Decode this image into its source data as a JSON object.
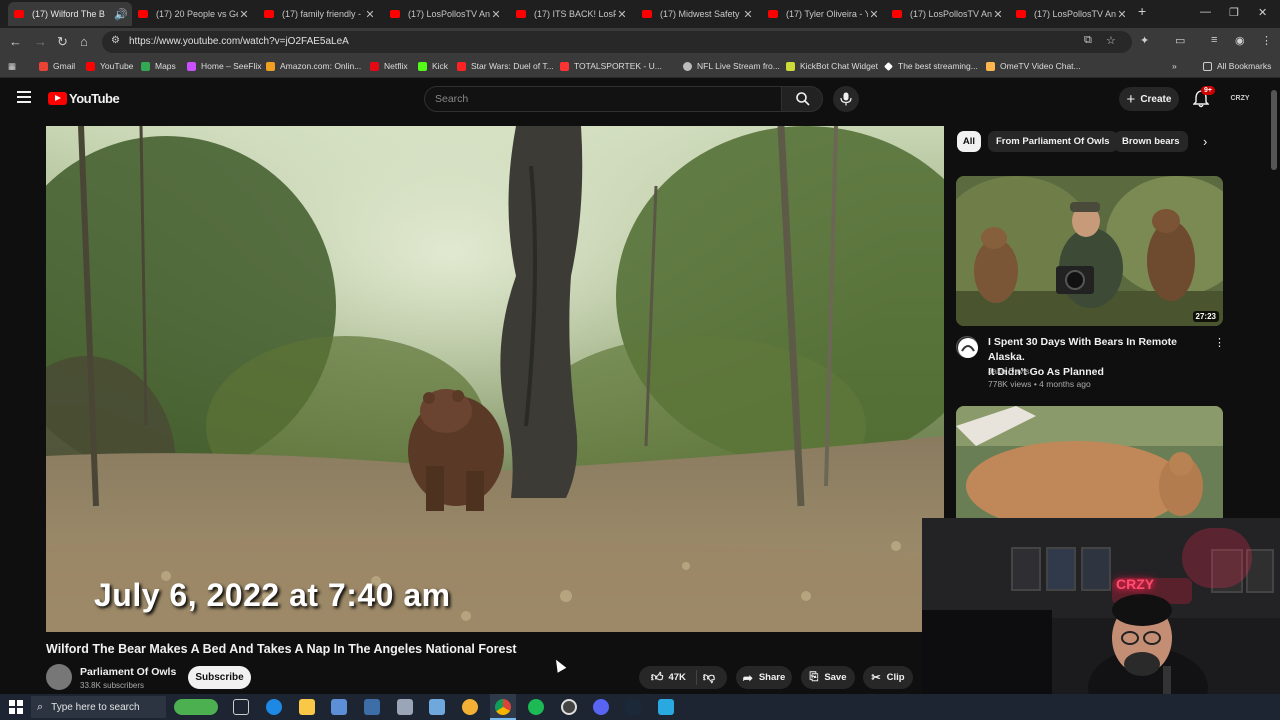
{
  "browser": {
    "tabs": [
      {
        "title": "(17) Wilford The B",
        "active": true
      },
      {
        "title": "(17) 20 People vs Gen"
      },
      {
        "title": "(17) family friendly - Y"
      },
      {
        "title": "(17) LosPollosTV And"
      },
      {
        "title": "(17) ITS BACK! LosPoll"
      },
      {
        "title": "(17) Midwest Safety -"
      },
      {
        "title": "(17) Tyler Oliveira - Yo"
      },
      {
        "title": "(17) LosPollosTV And"
      },
      {
        "title": "(17) LosPollosTV And"
      }
    ],
    "url": "https://www.youtube.com/watch?v=jO2FAE5aLeA",
    "bookmarks": [
      {
        "label": "Gmail",
        "color": "#ea4335"
      },
      {
        "label": "YouTube",
        "color": "#ff0000"
      },
      {
        "label": "Maps",
        "color": "#34a853"
      },
      {
        "label": "Home – SeeFlix",
        "color": "#c94fff"
      },
      {
        "label": "Amazon.com: Onlin...",
        "color": "#f0a020"
      },
      {
        "label": "Netflix",
        "color": "#e50914"
      },
      {
        "label": "Kick",
        "color": "#53fc18"
      },
      {
        "label": "Star Wars: Duel of T...",
        "color": "#ff2222"
      },
      {
        "label": "TOTALSPORTEK - U...",
        "color": "#ff3333"
      },
      {
        "label": "NFL Live Stream fro...",
        "color": "#bbbbbb"
      },
      {
        "label": "KickBot Chat Widget",
        "color": "#cddc39"
      },
      {
        "label": "The best streaming...",
        "color": "#ffffff"
      },
      {
        "label": "OmeTV Video Chat...",
        "color": "#ffb74d"
      }
    ],
    "all_bookmarks": "All Bookmarks"
  },
  "youtube": {
    "logo_text": "YouTube",
    "search_placeholder": "Search",
    "create_label": "Create",
    "notif_count": "9+",
    "avatar_text": "CRZY"
  },
  "video": {
    "date_overlay": "July 6, 2022 at 7:40 am",
    "title": "Wilford The Bear Makes A Bed And Takes A Nap In The Angeles National Forest",
    "channel": "Parliament Of Owls",
    "subscribers": "33.8K subscribers",
    "subscribe_label": "Subscribe",
    "likes": "47K",
    "share_label": "Share",
    "save_label": "Save",
    "clip_label": "Clip"
  },
  "sidebar": {
    "chips": [
      "All",
      "From Parliament Of Owls",
      "Brown bears"
    ],
    "recommendations": [
      {
        "title_line1": "I Spent 30 Days With Bears In Remote Alaska.",
        "title_line2": "It Didn't Go As Planned",
        "channel": "Jake Davis",
        "meta": "778K views • 4 months ago",
        "duration": "27:23"
      }
    ]
  },
  "webcam": {
    "sign_text": "CRZY"
  },
  "taskbar": {
    "search_placeholder": "Type here to search"
  }
}
